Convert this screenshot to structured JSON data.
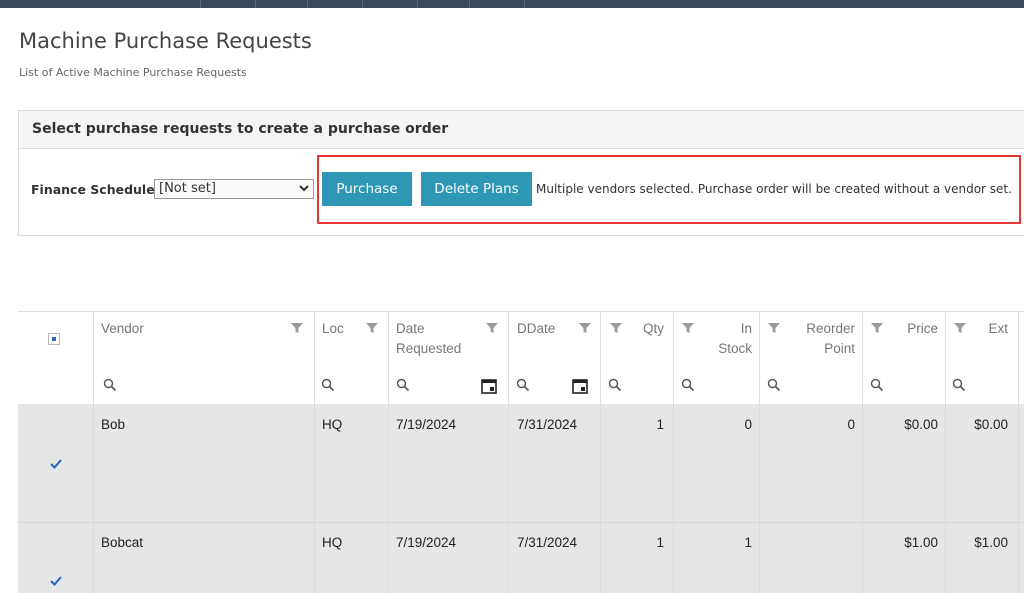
{
  "page": {
    "title": "Machine Purchase Requests",
    "subtitle": "List of Active Machine Purchase Requests"
  },
  "panel": {
    "heading": "Select purchase requests to create a purchase order",
    "finance_label": "Finance Schedule:",
    "finance_value": "[Not set]",
    "purchase_label": "Purchase",
    "delete_label": "Delete Plans",
    "message": "Multiple vendors selected. Purchase order will be created without a vendor set."
  },
  "grid": {
    "columns": {
      "vendor": "Vendor",
      "loc": "Loc",
      "date_requested": [
        "Date",
        "Requested"
      ],
      "ddate": "DDate",
      "qty": "Qty",
      "in_stock": [
        "In",
        "Stock"
      ],
      "reorder": [
        "Reorder",
        "Point"
      ],
      "price": "Price",
      "ext": "Ext"
    },
    "rows": [
      {
        "vendor": "Bob",
        "loc": "HQ",
        "date_requested": "7/19/2024",
        "ddate": "7/31/2024",
        "qty": "1",
        "in_stock": "0",
        "reorder": "0",
        "price": "$0.00",
        "ext": "$0.00",
        "checked": true
      },
      {
        "vendor": "Bobcat",
        "loc": "HQ",
        "date_requested": "7/19/2024",
        "ddate": "7/31/2024",
        "qty": "1",
        "in_stock": "1",
        "reorder": "",
        "price": "$1.00",
        "ext": "$1.00",
        "checked": true
      }
    ]
  },
  "colors": {
    "accent_button": "#2d97b5",
    "highlight_border": "#e53935",
    "row_selected_bg": "#e6e6e6",
    "check_color": "#2563c9"
  }
}
